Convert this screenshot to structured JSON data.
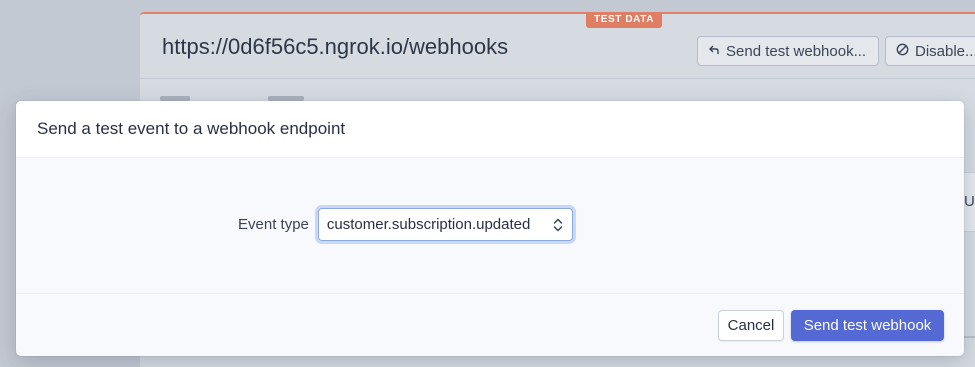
{
  "background": {
    "badge": "TEST DATA",
    "url": "https://0d6f56c5.ngrok.io/webhooks",
    "send_button": "Send test webhook...",
    "disable_button": "Disable...",
    "right_fragment": "U"
  },
  "modal": {
    "title": "Send a test event to a webhook endpoint",
    "field_label": "Event type",
    "event_type_value": "customer.subscription.updated",
    "cancel_label": "Cancel",
    "submit_label": "Send test webhook"
  },
  "colors": {
    "primary": "#5469d4",
    "badge": "#e07e63"
  }
}
